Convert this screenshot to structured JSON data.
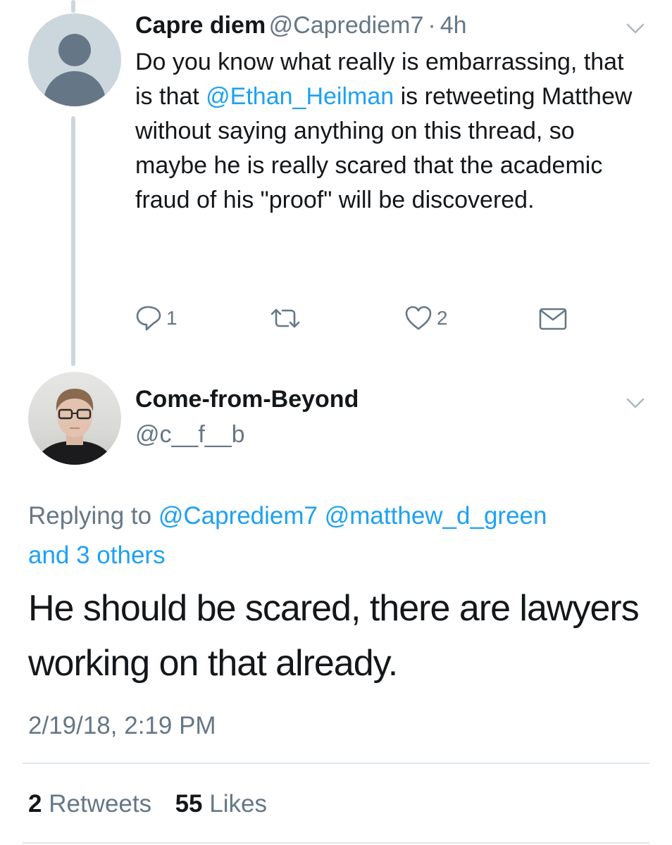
{
  "colors": {
    "text": "#14171a",
    "secondary": "#657786",
    "link": "#1da1f2",
    "thread_line": "#ccd6dd",
    "divider": "#e1e8ed"
  },
  "parent_tweet": {
    "author_name": "Capre diem",
    "author_handle": "@Caprediem7",
    "separator": "·",
    "age": "4h",
    "text_before_mention": "Do you know what really is embarrassing, that is that ",
    "mention": "@Ethan_Heilman",
    "text_after_mention": " is retweeting Matthew without saying anything on this thread, so maybe he is really scared that the academic fraud of his \"proof\" will be discovered.",
    "reply_count": "1",
    "like_count": "2",
    "icons": [
      "reply-icon",
      "retweet-icon",
      "like-icon",
      "direct-message-icon",
      "chevron-down-icon"
    ]
  },
  "main_tweet": {
    "author_name": "Come-from-Beyond",
    "author_handle": "@c__f__b",
    "replying_prefix": "Replying to ",
    "replying_mention_1": "@Caprediem7",
    "replying_mention_2": "@matthew_d_green",
    "replying_others": "and 3 others",
    "text": "He should be scared, there are lawyers working on that already.",
    "timestamp": "2/19/18, 2:19 PM",
    "retweets_count": "2",
    "retweets_label": "Retweets",
    "likes_count": "55",
    "likes_label": "Likes"
  }
}
